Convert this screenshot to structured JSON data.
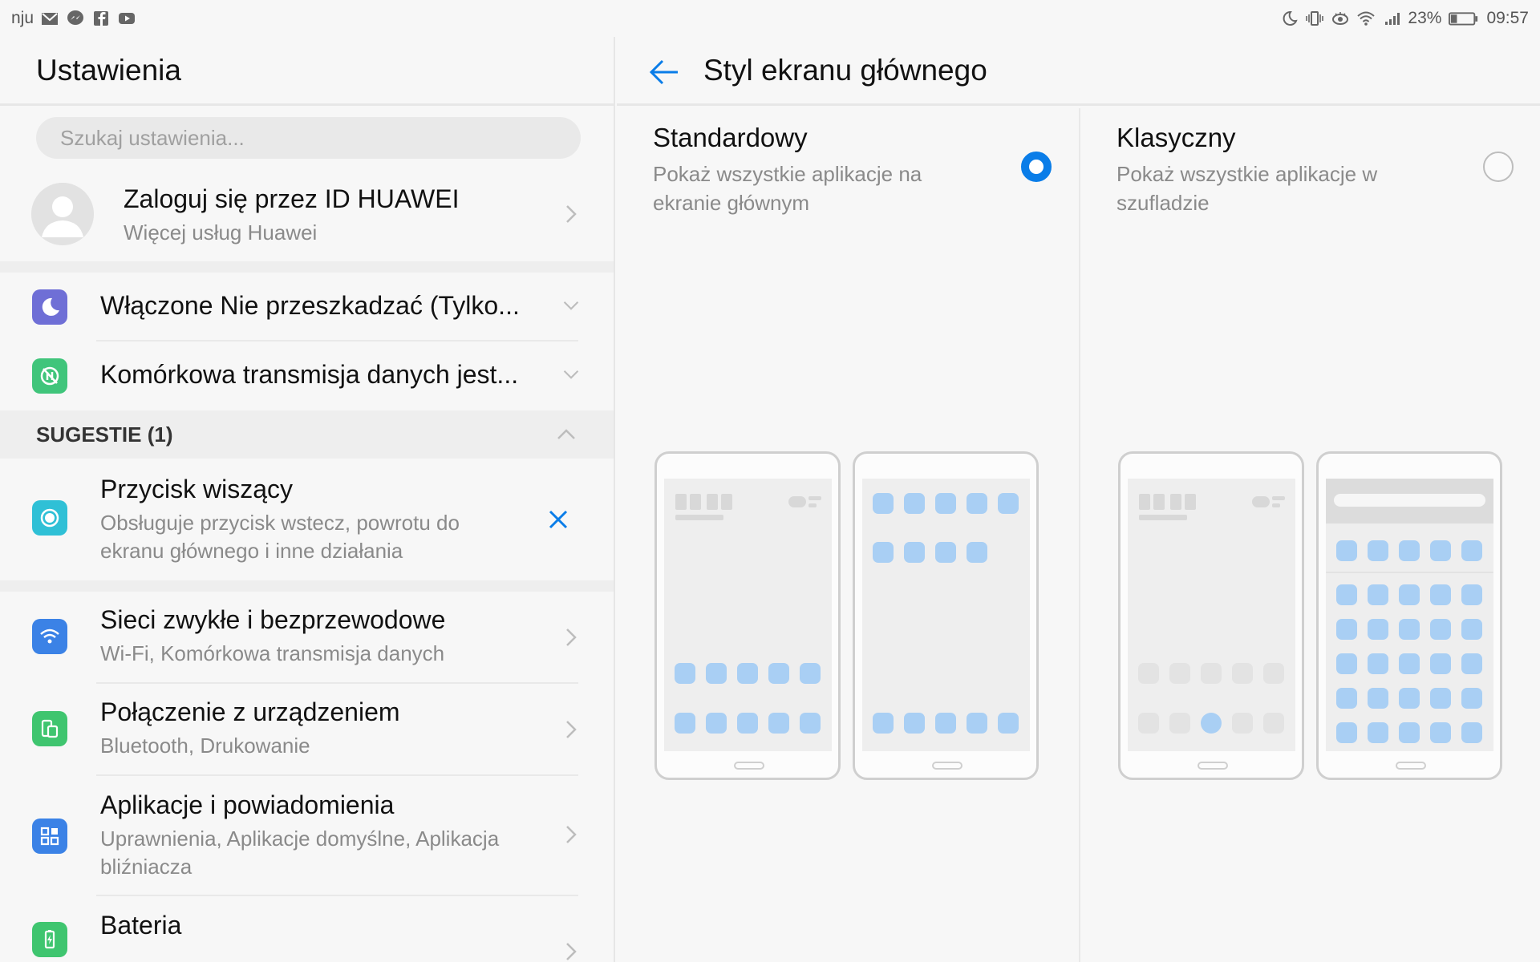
{
  "status_bar": {
    "carrier": "nju",
    "left_icons": [
      "gmail-icon",
      "messenger-icon",
      "facebook-icon",
      "youtube-icon"
    ],
    "right_icons": [
      "moon-icon",
      "vibrate-icon",
      "eye-comfort-icon",
      "wifi-icon",
      "signal-icon",
      "battery-icon"
    ],
    "battery": "23%",
    "time": "09:57"
  },
  "left": {
    "title": "Ustawienia",
    "search_placeholder": "Szukaj ustawienia...",
    "account": {
      "title": "Zaloguj się przez ID HUAWEI",
      "subtitle": "Więcej usług Huawei"
    },
    "quick": [
      {
        "icon": "moon-icon",
        "label": "Włączone Nie przeszkadzać (Tylko...",
        "color": "#6f6fd6"
      },
      {
        "icon": "data-off-icon",
        "label": "Komórkowa transmisja danych jest...",
        "color": "#40c57b"
      }
    ],
    "suggestions_header": "SUGESTIE (1)",
    "suggestion": {
      "icon": "floating-button-icon",
      "title": "Przycisk wiszący",
      "subtitle_line1": "Obsługuje przycisk wstecz, powrotu do",
      "subtitle_line2": "ekranu głównego i inne działania",
      "color": "#2fc0d6"
    },
    "items": [
      {
        "icon": "wifi-icon",
        "title": "Sieci zwykłe i bezprzewodowe",
        "subtitle": "Wi-Fi, Komórkowa transmisja danych",
        "color": "#3b82e6"
      },
      {
        "icon": "device-connection-icon",
        "title": "Połączenie z urządzeniem",
        "subtitle": "Bluetooth, Drukowanie",
        "color": "#3fc56f"
      },
      {
        "icon": "apps-icon",
        "title": "Aplikacje i powiadomienia",
        "subtitle_line1": "Uprawnienia, Aplikacje domyślne, Aplikacja",
        "subtitle_line2": "bliźniacza",
        "color": "#3b82e6"
      },
      {
        "icon": "battery-icon",
        "title": "Bateria",
        "color": "#3fc56f"
      }
    ]
  },
  "right": {
    "title": "Styl ekranu głównego",
    "options": [
      {
        "title": "Standardowy",
        "desc_line1": "Pokaż wszystkie aplikacje na",
        "desc_line2": "ekranie głównym",
        "selected": true
      },
      {
        "title": "Klasyczny",
        "desc_line1": "Pokaż wszystkie aplikacje w",
        "desc_line2": "szufladzie",
        "selected": false
      }
    ]
  },
  "colors": {
    "accent": "#0a7de8",
    "app_dot": "#a9cff4"
  }
}
